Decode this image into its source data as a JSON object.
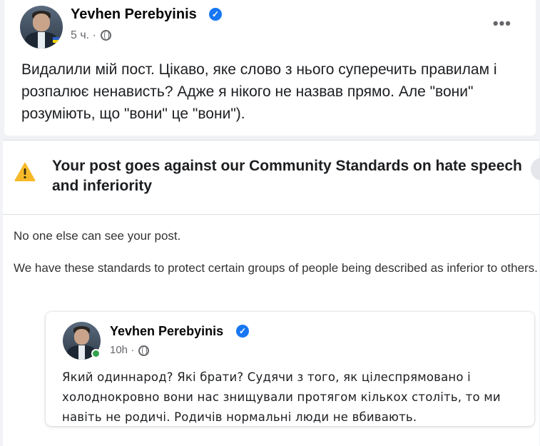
{
  "post": {
    "author": "Yevhen Perebyinis",
    "time": "5 ч. ·",
    "text": "Видалили мій пост. Цікаво, яке слово з нього суперечить правилам і розпалює ненависть? Адже я нікого не назвав прямо. Але \"вони\" розуміють, що \"вони\" це \"вони\")."
  },
  "notice": {
    "title": "Your post goes against our Community Standards on hate speech and inferiority",
    "line1": "No one else can see your post.",
    "line2": "We have these standards to protect certain groups of people being described as inferior to others."
  },
  "quoted_post": {
    "author": "Yevhen Perebyinis",
    "time": "10h ·",
    "text": "Який одиннарод? Які брати? Судячи з того, як цілеспрямовано і холоднокровно вони нас знищували протягом кількох століть, то ми навіть не родичі. Родичів нормальні люди не вбивають."
  },
  "icons": {
    "verified": "verified-badge-icon",
    "globe": "globe-icon",
    "more": "more-options-icon",
    "warning": "warning-icon"
  },
  "colors": {
    "verified": "#1877f2",
    "warning": "#f7b928",
    "online": "#31a24c",
    "meta_text": "#65676b"
  }
}
